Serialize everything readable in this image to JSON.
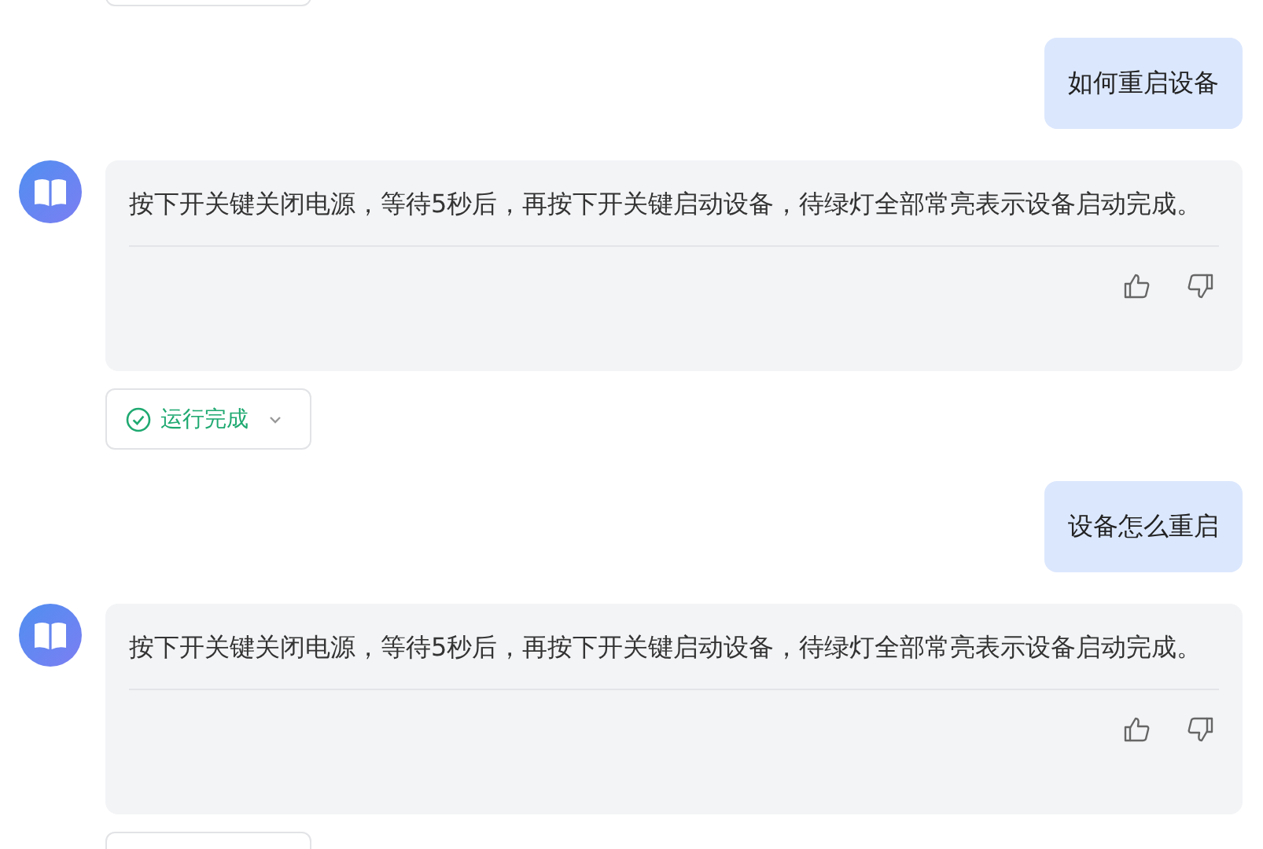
{
  "messages": [
    {
      "kind": "status"
    },
    {
      "kind": "user",
      "text": "如何重启设备"
    },
    {
      "kind": "bot",
      "text": "按下开关键关闭电源，等待5秒后，再按下开关键启动设备，待绿灯全部常亮表示设备启动完成。"
    },
    {
      "kind": "status",
      "label": "运行完成"
    },
    {
      "kind": "user",
      "text": "设备怎么重启"
    },
    {
      "kind": "bot",
      "text": "按下开关键关闭电源，等待5秒后，再按下开关键启动设备，待绿灯全部常亮表示设备启动完成。"
    },
    {
      "kind": "status"
    }
  ]
}
